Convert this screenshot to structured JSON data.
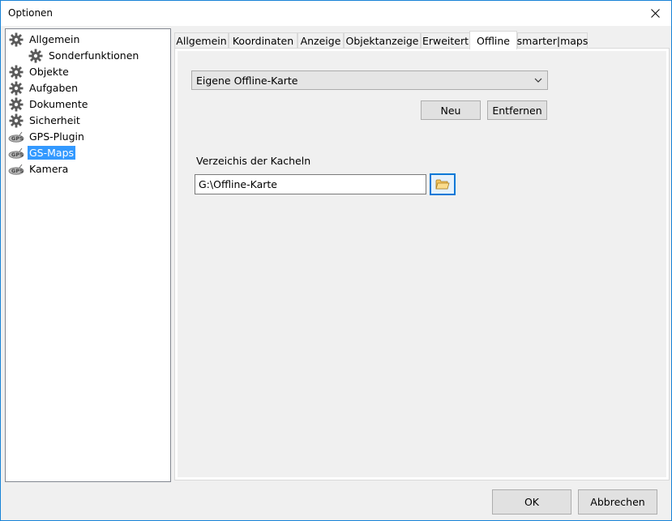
{
  "window": {
    "title": "Optionen"
  },
  "tree": {
    "items": [
      {
        "label": "Allgemein",
        "icon": "gear-icon"
      },
      {
        "label": "Sonderfunktionen",
        "icon": "gear-icon"
      },
      {
        "label": "Objekte",
        "icon": "gear-icon"
      },
      {
        "label": "Aufgaben",
        "icon": "gear-icon"
      },
      {
        "label": "Dokumente",
        "icon": "gear-icon"
      },
      {
        "label": "Sicherheit",
        "icon": "gear-icon"
      },
      {
        "label": "GPS-Plugin",
        "icon": "gps-satellite-icon"
      },
      {
        "label": "GS-Maps",
        "icon": "gps-satellite-icon",
        "selected": true
      },
      {
        "label": "Kamera",
        "icon": "gps-satellite-icon"
      }
    ]
  },
  "tabs": [
    {
      "label": "Allgemein"
    },
    {
      "label": "Koordinaten"
    },
    {
      "label": "Anzeige"
    },
    {
      "label": "Objektanzeige"
    },
    {
      "label": "Erweitert"
    },
    {
      "label": "Offline",
      "active": true
    },
    {
      "label": "smarter|maps"
    }
  ],
  "offline": {
    "map_select_value": "Eigene Offline-Karte",
    "new_label": "Neu",
    "remove_label": "Entfernen",
    "directory_label": "Verzeichis der Kacheln",
    "directory_value": "G:\\Offline-Karte"
  },
  "footer": {
    "ok_label": "OK",
    "cancel_label": "Abbrechen"
  },
  "colors": {
    "selection": "#3399ff",
    "window_border": "#1883d7",
    "focus_border": "#0078d7"
  }
}
